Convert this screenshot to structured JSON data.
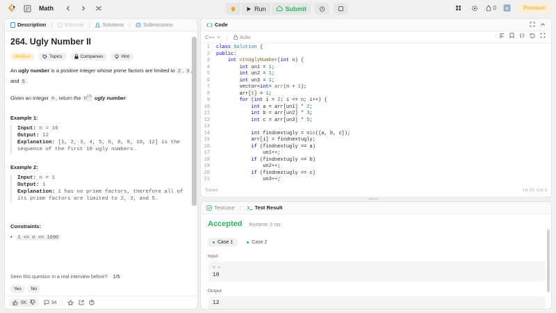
{
  "topbar": {
    "problem_list": "Math",
    "run_label": "Run",
    "submit_label": "Submit",
    "streak_count": "0",
    "premium_label": "Premium"
  },
  "left": {
    "tabs": [
      "Description",
      "Editorial",
      "Solutions",
      "Submissions"
    ],
    "title": "264. Ugly Number II",
    "chips": [
      "Medium",
      "Topics",
      "Companies",
      "Hint"
    ],
    "para1_pre": "An ",
    "para1_bold": "ugly number",
    "para1_mid": " is a positive integer whose prime factors are limited to ",
    "para1_c1": "2",
    "para1_c2": "3",
    "para1_and": "and",
    "para1_c3": "5",
    "para2_pre": "Given an integer ",
    "para2_code": "n",
    "para2_mid": ", return the ",
    "para2_sup_base": "n",
    "para2_sup": "th",
    "para2_bold": "ugly number",
    "ex1_title": "Example 1:",
    "ex1_input_label": "Input:",
    "ex1_input": "n = 10",
    "ex1_output_label": "Output:",
    "ex1_output": "12",
    "ex1_expl_label": "Explanation:",
    "ex1_expl_1": "[1, 2, 3, 4, 5, 6, 8, 9, 10, 12] is the",
    "ex1_expl_2": "sequence of the first 10 ugly numbers.",
    "ex2_title": "Example 2:",
    "ex2_input_label": "Input:",
    "ex2_input": "n = 1",
    "ex2_output_label": "Output:",
    "ex2_output": "1",
    "ex2_expl_label": "Explanation:",
    "ex2_expl_1": "1 has no prime factors, therefore all of",
    "ex2_expl_2": "its prime factors are limited to 2, 3, and 5.",
    "constraints_title": "Constraints:",
    "constraint_1": "1 <= n <= 1690",
    "seen_question": "Seen this question in a real interview before?",
    "seen_page": "1/5",
    "yes": "Yes",
    "no": "No",
    "likes": "6K",
    "comments": "34"
  },
  "code": {
    "tab_label": "Code",
    "language": "C++",
    "auto_label": "Auto",
    "saved": "Saved",
    "cursor": "Ln 23, Col 3",
    "lines": [
      {
        "n": "1",
        "html": "<span class='kw'>class</span> <span class='ty'>Solution</span> {"
      },
      {
        "n": "2",
        "html": "<span class='kw'>public</span>:"
      },
      {
        "n": "3",
        "html": "    <span class='kw'>int</span> <span class='fn'>nthUglyNumber</span>(<span class='kw'>int</span> n) {"
      },
      {
        "n": "4",
        "html": "        <span class='kw'>int</span> un1 = <span class='num'>1</span>;"
      },
      {
        "n": "5",
        "html": "        <span class='kw'>int</span> un2 = <span class='num'>1</span>;"
      },
      {
        "n": "6",
        "html": "        <span class='kw'>int</span> un3 = <span class='num'>1</span>;"
      },
      {
        "n": "7",
        "html": "        vector&lt;<span class='kw'>int</span>&gt; <span class='fn'>arr</span>(n + <span class='num'>1</span>);"
      },
      {
        "n": "8",
        "html": "        arr[<span class='num'>1</span>] = <span class='num'>1</span>;"
      },
      {
        "n": "9",
        "html": "        <span class='kw'>for</span> (<span class='kw'>int</span> i = <span class='num'>2</span>; i &lt;= n; i++) {"
      },
      {
        "n": "10",
        "html": "            <span class='kw'>int</span> a = arr[un1] * <span class='num'>2</span>;"
      },
      {
        "n": "11",
        "html": "            <span class='kw'>int</span> b = arr[un2] * <span class='num'>3</span>;"
      },
      {
        "n": "12",
        "html": "            <span class='kw'>int</span> c = arr[un3] * <span class='num'>5</span>;"
      },
      {
        "n": "13",
        "html": ""
      },
      {
        "n": "14",
        "html": "            <span class='kw'>int</span> findnextugly = <span class='fn'>min</span>({a, b, c});"
      },
      {
        "n": "15",
        "html": "            arr[i] = findnextugly;"
      },
      {
        "n": "16",
        "html": "            <span class='kw'>if</span> (findnextugly == a)"
      },
      {
        "n": "17",
        "html": "                un1++;"
      },
      {
        "n": "18",
        "html": "            <span class='kw'>if</span> (findnextugly == b)"
      },
      {
        "n": "19",
        "html": "                un2++;"
      },
      {
        "n": "20",
        "html": "            <span class='kw'>if</span> (findnextugly == c)"
      },
      {
        "n": "21",
        "html": "                un3++;"
      }
    ]
  },
  "result": {
    "tabs": [
      "Testcase",
      "Test Result"
    ],
    "status": "Accepted",
    "runtime": "Runtime: 0 ms",
    "cases": [
      "Case 1",
      "Case 2"
    ],
    "input_label": "Input",
    "input_var": "n =",
    "input_val": "10",
    "output_label": "Output",
    "output_val": "12"
  }
}
